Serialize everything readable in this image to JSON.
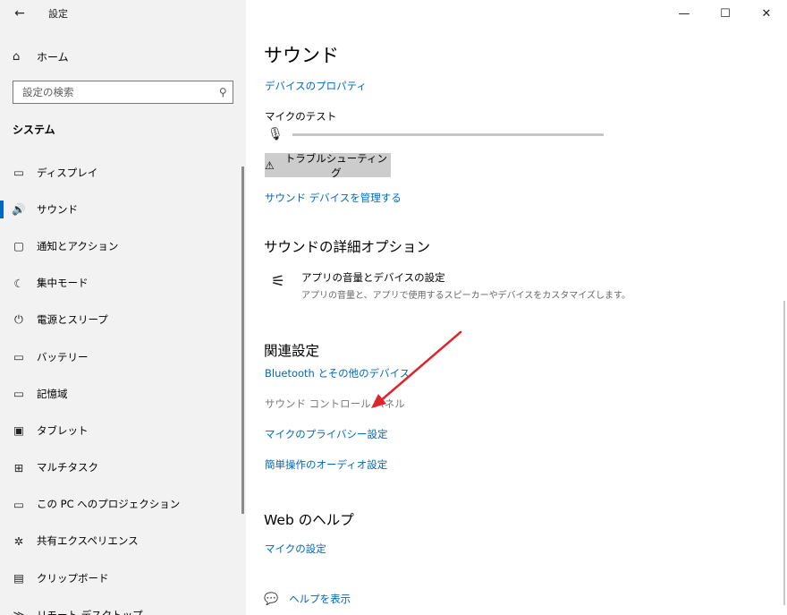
{
  "window": {
    "title": "設定",
    "back_icon": "←",
    "minimize_icon": "—",
    "maximize_icon": "☐",
    "close_icon": "✕"
  },
  "sidebar": {
    "home_label": "ホーム",
    "home_icon": "⌂",
    "search_placeholder": "設定の検索",
    "search_icon": "⚲",
    "section_label": "システム",
    "items": [
      {
        "label": "ディスプレイ",
        "icon": "▭",
        "active": false
      },
      {
        "label": "サウンド",
        "icon": "🔊",
        "active": true
      },
      {
        "label": "通知とアクション",
        "icon": "▢",
        "active": false
      },
      {
        "label": "集中モード",
        "icon": "☾",
        "active": false
      },
      {
        "label": "電源とスリープ",
        "icon": "⏻",
        "active": false
      },
      {
        "label": "バッテリー",
        "icon": "▭",
        "active": false
      },
      {
        "label": "記憶域",
        "icon": "▭",
        "active": false
      },
      {
        "label": "タブレット",
        "icon": "▣",
        "active": false
      },
      {
        "label": "マルチタスク",
        "icon": "⊞",
        "active": false
      },
      {
        "label": "この PC へのプロジェクション",
        "icon": "▭",
        "active": false
      },
      {
        "label": "共有エクスペリエンス",
        "icon": "✲",
        "active": false
      },
      {
        "label": "クリップボード",
        "icon": "▤",
        "active": false
      },
      {
        "label": "リモート デスクトップ",
        "icon": "≫",
        "active": false
      }
    ]
  },
  "main": {
    "title": "サウンド",
    "device_properties_link": "デバイスのプロパティ",
    "mic_test_label": "マイクのテスト",
    "mic_icon": "🎙",
    "troubleshoot_icon": "⚠",
    "troubleshoot_label": "トラブルシューティング",
    "manage_devices_link": "サウンド デバイスを管理する",
    "advanced_heading": "サウンドの詳細オプション",
    "app_volume_icon": "⚟",
    "app_volume_title": "アプリの音量とデバイスの設定",
    "app_volume_desc": "アプリの音量と、アプリで使用するスピーカーやデバイスをカスタマイズします。",
    "related_heading": "関連設定",
    "bluetooth_link": "Bluetooth とその他のデバイス",
    "sound_control_panel_link": "サウンド コントロール パネル",
    "mic_privacy_link": "マイクのプライバシー設定",
    "ease_audio_link": "簡単操作のオーディオ設定",
    "web_help_heading": "Web のヘルプ",
    "mic_settings_link": "マイクの設定",
    "help_icon": "💬",
    "help_link": "ヘルプを表示"
  },
  "colors": {
    "accent": "#0067c0",
    "sidebar_bg": "#f2f2f2",
    "annotation_arrow": "#e0242b"
  }
}
